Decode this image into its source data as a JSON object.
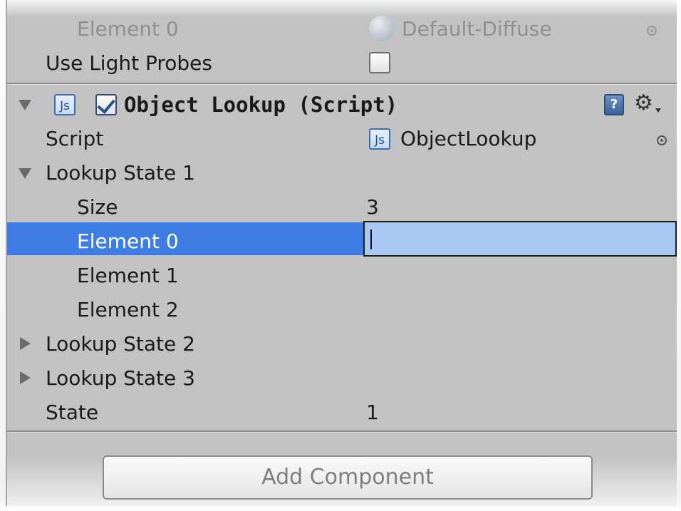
{
  "material_section": {
    "element0_label": "Element 0",
    "element0_value": "Default-Diffuse",
    "light_probes_label": "Use Light Probes",
    "light_probes_checked": false
  },
  "component": {
    "title": "Object Lookup (Script)",
    "enabled": true,
    "script_label": "Script",
    "script_value": "ObjectLookup",
    "js_icon_text": "Js",
    "help_icon_text": "?",
    "gear_icon_glyph": "⚙",
    "fields": {
      "lookup_state_1": "Lookup State 1",
      "size_label": "Size",
      "size_value": "3",
      "element0": "Element 0",
      "element0_value": "",
      "element1": "Element 1",
      "element2": "Element 2",
      "lookup_state_2": "Lookup State 2",
      "lookup_state_3": "Lookup State 3",
      "state_label": "State",
      "state_value": "1"
    }
  },
  "add_component_label": "Add Component",
  "colors": {
    "panel_bg": "#c2c2c2",
    "selection": "#3e7de3",
    "edit_field": "#a9c8f3"
  }
}
